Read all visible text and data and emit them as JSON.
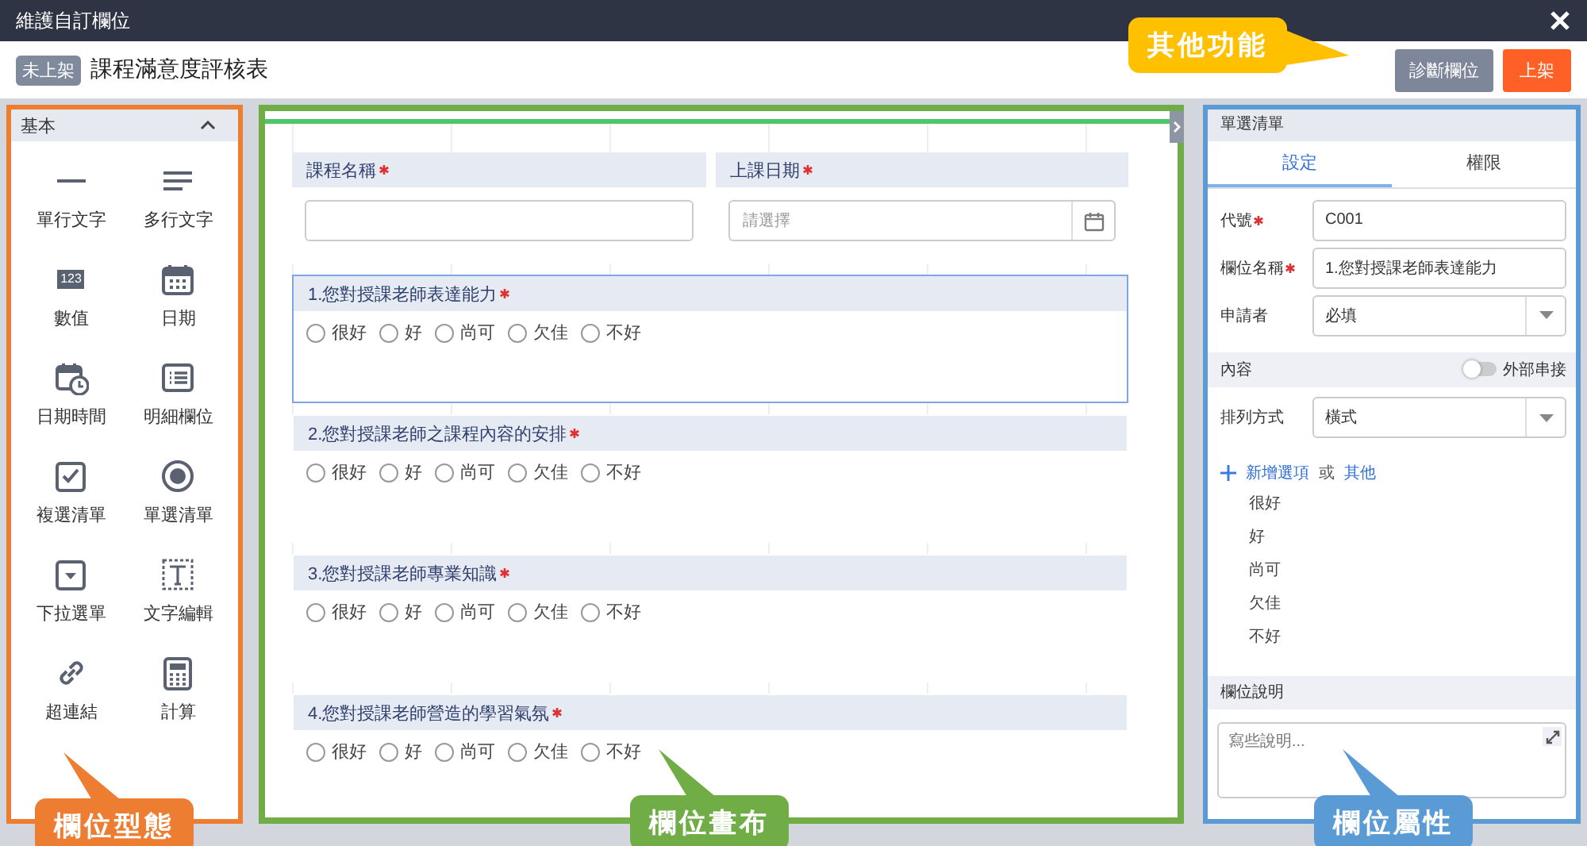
{
  "window": {
    "title": "維護自訂欄位"
  },
  "header": {
    "status_badge": "未上架",
    "form_title": "課程滿意度評核表",
    "buttons": [
      {
        "label": "診斷欄位",
        "kind": "secondary"
      },
      {
        "label": "上架",
        "kind": "primary"
      }
    ],
    "annotation": {
      "text": "其他功能",
      "color": "#ffc000"
    }
  },
  "field_types": {
    "group": {
      "label": "基本",
      "expanded": true
    },
    "annotation": {
      "text": "欄位型態",
      "color": "#ed7d31"
    },
    "items": [
      {
        "label": "單行文字",
        "kind": "line"
      },
      {
        "label": "多行文字",
        "kind": "lines"
      },
      {
        "label": "數值",
        "kind": "number",
        "icon_text": "123"
      },
      {
        "label": "日期",
        "kind": "date"
      },
      {
        "label": "日期時間",
        "kind": "datetime"
      },
      {
        "label": "明細欄位",
        "kind": "detail"
      },
      {
        "label": "複選清單",
        "kind": "checkbox"
      },
      {
        "label": "單選清單",
        "kind": "radio"
      },
      {
        "label": "下拉選單",
        "kind": "dropdown"
      },
      {
        "label": "文字編輯",
        "kind": "text"
      },
      {
        "label": "超連結",
        "kind": "link"
      },
      {
        "label": "計算",
        "kind": "calc"
      }
    ]
  },
  "canvas": {
    "annotation": {
      "text": "欄位畫布",
      "color": "#70ad47"
    },
    "top_fields": [
      {
        "label": "課程名稱",
        "required": true,
        "kind": "text"
      },
      {
        "label": "上課日期",
        "required": true,
        "kind": "date",
        "placeholder": "請選擇"
      }
    ],
    "questions": [
      {
        "label": "1.您對授課老師表達能力",
        "required": true,
        "selected": true,
        "options": [
          {
            "label": "很好",
            "selected": false
          },
          {
            "label": "好",
            "selected": false
          },
          {
            "label": "尚可",
            "selected": false
          },
          {
            "label": "欠佳",
            "selected": false
          },
          {
            "label": "不好",
            "selected": false
          }
        ]
      },
      {
        "label": "2.您對授課老師之課程內容的安排",
        "required": true,
        "selected": false,
        "options": [
          {
            "label": "很好",
            "selected": false
          },
          {
            "label": "好",
            "selected": false
          },
          {
            "label": "尚可",
            "selected": false
          },
          {
            "label": "欠佳",
            "selected": false
          },
          {
            "label": "不好",
            "selected": false
          }
        ]
      },
      {
        "label": "3.您對授課老師專業知識",
        "required": true,
        "selected": false,
        "options": [
          {
            "label": "很好",
            "selected": false
          },
          {
            "label": "好",
            "selected": false
          },
          {
            "label": "尚可",
            "selected": false
          },
          {
            "label": "欠佳",
            "selected": false
          },
          {
            "label": "不好",
            "selected": false
          }
        ]
      },
      {
        "label": "4.您對授課老師營造的學習氣氛",
        "required": true,
        "selected": false,
        "options": [
          {
            "label": "很好",
            "selected": false
          },
          {
            "label": "好",
            "selected": false
          },
          {
            "label": "尚可",
            "selected": false
          },
          {
            "label": "欠佳",
            "selected": false
          },
          {
            "label": "不好",
            "selected": false
          }
        ]
      }
    ]
  },
  "properties": {
    "annotation": {
      "text": "欄位屬性",
      "color": "#5b9bd5"
    },
    "title": "單選清單",
    "tabs": [
      {
        "label": "設定",
        "selected": true
      },
      {
        "label": "權限",
        "selected": false
      }
    ],
    "fields": [
      {
        "label": "代號",
        "required": true,
        "kind": "input",
        "value": "C001"
      },
      {
        "label": "欄位名稱",
        "required": true,
        "kind": "input",
        "value": "1.您對授課老師表達能力"
      },
      {
        "label": "申請者",
        "required": false,
        "kind": "select",
        "value": "必填"
      }
    ],
    "content_section": {
      "label": "內容",
      "toggle": {
        "label": "外部串接",
        "on": false
      }
    },
    "layout_field": {
      "label": "排列方式",
      "required": false,
      "kind": "select",
      "value": "橫式"
    },
    "add_option": {
      "label": "新增選項",
      "separator": "或",
      "other": "其他"
    },
    "options": [
      "很好",
      "好",
      "尚可",
      "欠佳",
      "不好"
    ],
    "description": {
      "label": "欄位說明",
      "placeholder": "寫些說明..."
    }
  }
}
